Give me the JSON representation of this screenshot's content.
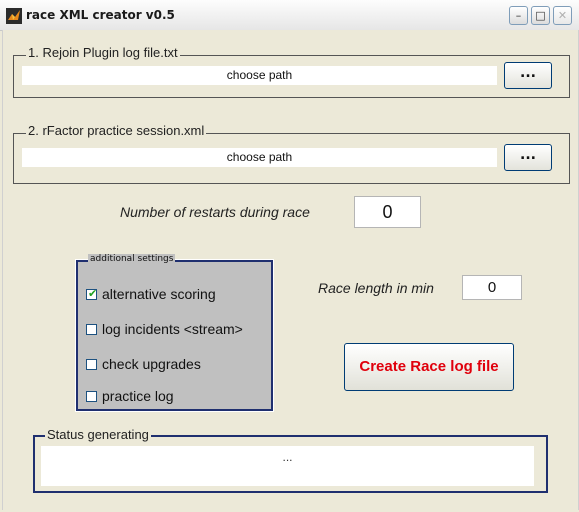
{
  "window": {
    "title": "race XML creator v0.5",
    "controls": {
      "minimize": "–",
      "maximize": "□",
      "close": "✕"
    }
  },
  "rejoin_group": {
    "legend": "1. Rejoin Plugin log file.txt",
    "path_text": "choose path",
    "browse_label": "..."
  },
  "session_group": {
    "legend": "2. rFactor practice session.xml",
    "path_text": "choose path",
    "browse_label": "..."
  },
  "restarts": {
    "label": "Number of restarts during race",
    "value": "0"
  },
  "settings": {
    "legend": "additional settings",
    "options": [
      {
        "label": "alternative scoring",
        "checked": true
      },
      {
        "label": "log incidents <stream>",
        "checked": false
      },
      {
        "label": "check upgrades",
        "checked": false
      },
      {
        "label": "practice log",
        "checked": false
      }
    ]
  },
  "race_length": {
    "label": "Race length in min",
    "value": "0"
  },
  "create_button": {
    "label": "Create Race log file"
  },
  "status": {
    "legend": "Status generating",
    "text": "..."
  },
  "colors": {
    "create_text": "#e0000c",
    "group_border": "#1f2f6f",
    "check_mark": "#21a121"
  },
  "icons": {
    "app": "matlab-icon",
    "check": "checkmark"
  }
}
